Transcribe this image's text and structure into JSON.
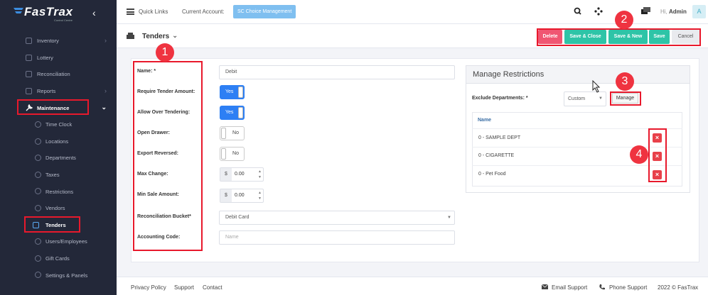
{
  "sidebar": {
    "brand": "FasTrax",
    "tagline": "Control Centre",
    "items": [
      {
        "label": "Inventory",
        "icon": "inventory-icon",
        "chevron": true
      },
      {
        "label": "Lottery",
        "icon": "lottery-icon"
      },
      {
        "label": "Reconciliation",
        "icon": "reconciliation-icon"
      },
      {
        "label": "Reports",
        "icon": "reports-icon",
        "chevron": true
      },
      {
        "label": "Maintenance",
        "icon": "wrench-icon",
        "expanded": true
      },
      {
        "label": "Time Clock",
        "icon": "clock-icon"
      },
      {
        "label": "Locations",
        "icon": "location-icon"
      },
      {
        "label": "Departments",
        "icon": "departments-icon"
      },
      {
        "label": "Taxes",
        "icon": "taxes-icon"
      },
      {
        "label": "Restrictions",
        "icon": "restrictions-icon"
      },
      {
        "label": "Vendors",
        "icon": "vendors-icon"
      },
      {
        "label": "Tenders",
        "icon": "tenders-icon",
        "active": true
      },
      {
        "label": "Users/Employees",
        "icon": "users-icon"
      },
      {
        "label": "Gift Cards",
        "icon": "gift-card-icon"
      },
      {
        "label": "Settings & Panels",
        "icon": "settings-icon"
      }
    ]
  },
  "topbar": {
    "quick_links": "Quick Links",
    "current_account_label": "Current Account:",
    "current_account": "SC Choice Management",
    "greeting": "Hi,",
    "user": "Admin",
    "avatar": "A"
  },
  "page": {
    "title": "Tenders",
    "buttons": {
      "delete": "Delete",
      "save_close": "Save & Close",
      "save_new": "Save & New",
      "save": "Save",
      "cancel": "Cancel"
    }
  },
  "form": {
    "name_label": "Name: *",
    "name_value": "Debit",
    "require_label": "Require Tender Amount:",
    "require_value": "Yes",
    "allow_label": "Allow Over Tendering:",
    "allow_value": "Yes",
    "open_label": "Open Drawer:",
    "open_value": "No",
    "export_label": "Export Reversed:",
    "export_value": "No",
    "max_label": "Max Change:",
    "max_value": "0.00",
    "min_label": "Min Sale Amount:",
    "min_value": "0.00",
    "currency": "$",
    "bucket_label": "Reconciliation Bucket*",
    "bucket_value": "Debit Card",
    "accounting_label": "Accounting Code:",
    "accounting_placeholder": "Name"
  },
  "restrictions": {
    "title": "Manage Restrictions",
    "exclude_label": "Exclude Departments: *",
    "exclude_value": "Custom",
    "manage": "Manage",
    "column": "Name",
    "rows": [
      "0 - SAMPLE DEPT",
      "0 - CIGARETTE",
      "0 - Pet Food"
    ]
  },
  "callouts": [
    "1",
    "2",
    "3",
    "4"
  ],
  "footer": {
    "privacy": "Privacy Policy",
    "support": "Support",
    "contact": "Contact",
    "email_support": "Email Support",
    "phone_support": "Phone Support",
    "copyright": "2022 © FasTrax"
  },
  "colors": {
    "sidebar": "#232839",
    "accent_teal": "#2ec4a7",
    "delete_red": "#f05672",
    "toggle_blue": "#2d7ff4",
    "highlight_red": "#e8192c"
  }
}
